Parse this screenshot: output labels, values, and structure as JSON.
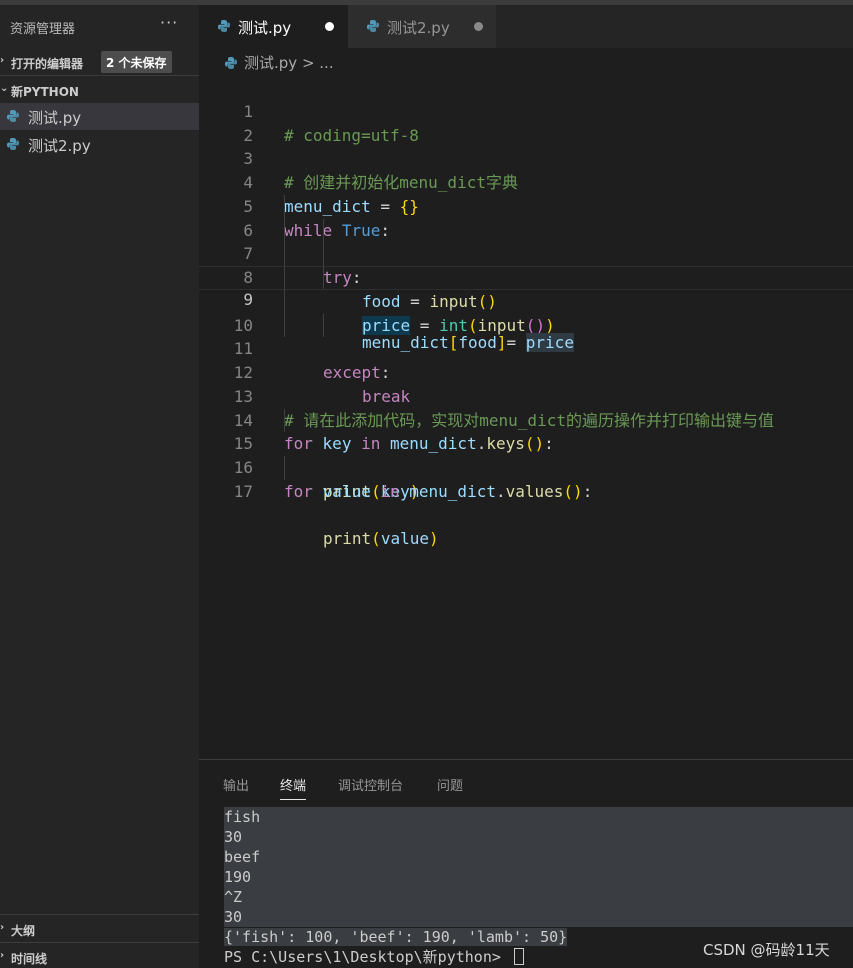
{
  "sidebar": {
    "title": "资源管理器",
    "more": "···",
    "open_editors": {
      "label": "打开的编辑器",
      "badge": "2 个未保存"
    },
    "folder": {
      "label": "新PYTHON"
    },
    "files": [
      {
        "name": "测试.py",
        "active": true
      },
      {
        "name": "测试2.py",
        "active": false
      }
    ],
    "outline": {
      "label": "大纲"
    },
    "timeline": {
      "label": "时间线"
    }
  },
  "tabs": [
    {
      "name": "测试.py",
      "active": true,
      "unsaved": true
    },
    {
      "name": "测试2.py",
      "active": false,
      "unsaved": true
    }
  ],
  "breadcrumb": {
    "file": "测试.py",
    "rest": "> ..."
  },
  "editor": {
    "current_line": 9,
    "lines": [
      {
        "n": "1"
      },
      {
        "n": "2"
      },
      {
        "n": "3"
      },
      {
        "n": "4"
      },
      {
        "n": "5"
      },
      {
        "n": "6"
      },
      {
        "n": "7"
      },
      {
        "n": "8"
      },
      {
        "n": "9"
      },
      {
        "n": "10"
      },
      {
        "n": "11"
      },
      {
        "n": "12"
      },
      {
        "n": "13"
      },
      {
        "n": "14"
      },
      {
        "n": "15"
      },
      {
        "n": "16"
      },
      {
        "n": "17"
      }
    ],
    "tokens": {
      "l1": "# coding=utf-8",
      "l3": "# 创建并初始化menu_dict字典",
      "menu_dict": "menu_dict",
      "eq": " = ",
      "braces": "{}",
      "while": "while",
      "true": "True",
      "colon": ":",
      "try": "try",
      "food": "food",
      "input": "input",
      "lp": "(",
      "rp": ")",
      "price": "price",
      "int": "int",
      "lb": "[",
      "rb": "]",
      "assign_tight": "= ",
      "except": "except",
      "break": "break",
      "l13": "# 请在此添加代码，实现对menu_dict的遍历操作并打印输出键与值",
      "for": "for",
      "key": "key",
      "in": "in",
      "dot": ".",
      "keys": "keys",
      "print": "print",
      "value": "value",
      "values": "values",
      "sp": " "
    }
  },
  "panel": {
    "tabs": [
      {
        "label": "输出",
        "active": false
      },
      {
        "label": "终端",
        "active": true
      },
      {
        "label": "调试控制台",
        "active": false
      },
      {
        "label": "问题",
        "active": false
      }
    ]
  },
  "terminal": {
    "lines": [
      "fish",
      "30",
      "beef",
      "190",
      "^Z",
      "30",
      "{'fish': 100, 'beef': 190, 'lamb': 50}"
    ],
    "prompt": "PS C:\\Users\\1\\Desktop\\新python> "
  },
  "watermark": "CSDN @码龄11天",
  "colors": {
    "background": "#1e1e1e",
    "sidebar": "#252526",
    "comment": "#6a9955",
    "keyword": "#c586c0",
    "variable": "#9cdcfe",
    "function": "#dcdcaa",
    "builtin_type": "#4ec9b0",
    "constant": "#569cd6",
    "bracket": "#ffd700"
  }
}
